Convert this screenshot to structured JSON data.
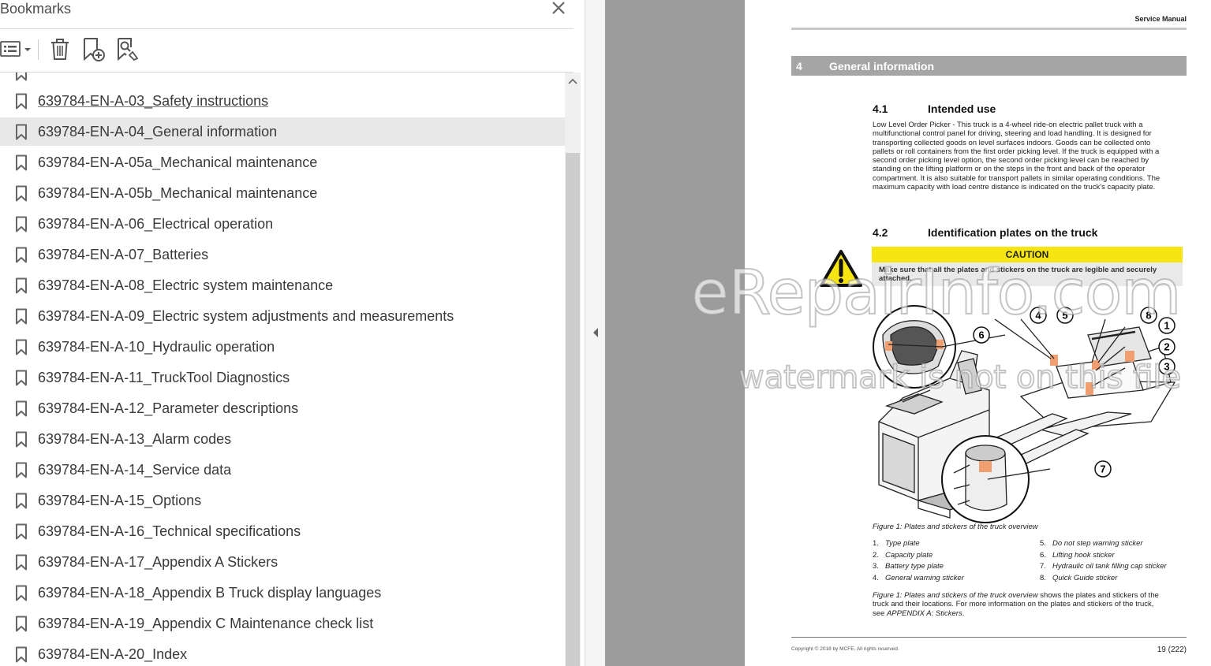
{
  "panel": {
    "title": "Bookmarks",
    "toolbar": {
      "options_icon": "list-options-icon",
      "delete_icon": "trash-icon",
      "new_bookmark_icon": "bookmark-add-icon",
      "find_bookmark_icon": "bookmark-find-icon"
    },
    "items": [
      "639784-EN-A-03_Safety instructions",
      "639784-EN-A-04_General information",
      "639784-EN-A-05a_Mechanical maintenance",
      "639784-EN-A-05b_Mechanical maintenance",
      "639784-EN-A-06_Electrical operation",
      "639784-EN-A-07_Batteries",
      "639784-EN-A-08_Electric system maintenance",
      "639784-EN-A-09_Electric system adjustments and measurements",
      "639784-EN-A-10_Hydraulic operation",
      "639784-EN-A-11_TruckTool Diagnostics",
      "639784-EN-A-12_Parameter descriptions",
      "639784-EN-A-13_Alarm codes",
      "639784-EN-A-14_Service data",
      "639784-EN-A-15_Options",
      "639784-EN-A-16_Technical specifications",
      "639784-EN-A-17_Appendix A Stickers",
      "639784-EN-A-18_Appendix B Truck display languages",
      "639784-EN-A-19_Appendix C Maintenance check list",
      "639784-EN-A-20_Index"
    ],
    "selected_index": 1
  },
  "document": {
    "header": "Service Manual",
    "section_number": "4",
    "section_title": "General information",
    "sub1_number": "4.1",
    "sub1_title": "Intended use",
    "sub1_text": "Low Level Order Picker - This truck is a 4-wheel ride-on electric pallet truck with a multifunctional control panel for driving, steering and load handling. It is designed for transporting collected goods on level surfaces indoors. Goods can be collected onto pallets or roll containers from the first order picking level. If the truck is equipped with a second order picking level option, the second order picking level can be reached by standing on the lifting platform or on the steps in the front and back of the operator compartment. It is also suitable for transport pallets in similar operating conditions. The maximum capacity with load centre distance is indicated on the truck's capacity plate.",
    "sub2_number": "4.2",
    "sub2_title": "Identification plates on the truck",
    "caution_label": "CAUTION",
    "caution_text": "Make sure that all the plates and stickers on the truck are legible and securely attached.",
    "figure_caption": "Figure 1: Plates and stickers of the truck overview",
    "figure_callouts": [
      "1",
      "2",
      "3",
      "4",
      "5",
      "6",
      "7",
      "8"
    ],
    "legend": [
      {
        "n": "1.",
        "t": "Type plate"
      },
      {
        "n": "2.",
        "t": "Capacity plate"
      },
      {
        "n": "3.",
        "t": "Battery type plate"
      },
      {
        "n": "4.",
        "t": "General warning sticker"
      },
      {
        "n": "5.",
        "t": "Do not step warning sticker"
      },
      {
        "n": "6.",
        "t": "Lifting hook sticker"
      },
      {
        "n": "7.",
        "t": "Hydraulic oil tank filling cap sticker"
      },
      {
        "n": "8.",
        "t": "Quick Guide sticker"
      }
    ],
    "closing_ref": "Figure 1: Plates and stickers of the truck overview",
    "closing_text": " shows the plates and stickers of the truck and their locations. For more information on the plates and stickers of the truck, see ",
    "closing_link": "APPENDIX A: Stickers",
    "closing_end": ".",
    "copyright": "Copyright © 2018 by MCFE. All rights reserved.",
    "page_number": "19 (222)"
  },
  "watermark": {
    "line1": "eRepairInfo.com",
    "line2": "watermark is not on this file"
  },
  "colors": {
    "caution_yellow": "#f7e512",
    "section_bar": "#a5a5a5",
    "viewer_bg": "#9c9c9c",
    "selected_row": "#e8e8e8"
  }
}
